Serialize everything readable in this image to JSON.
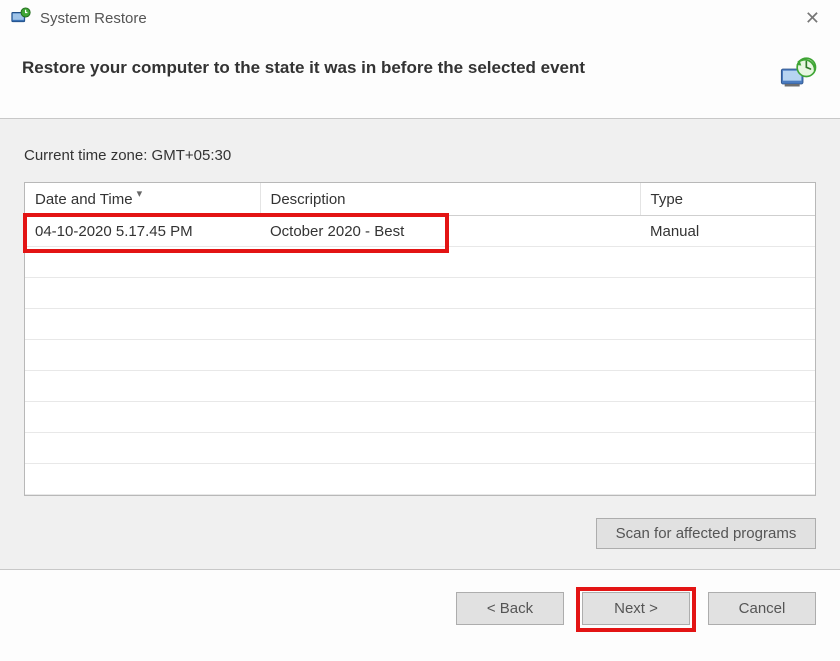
{
  "window": {
    "title": "System Restore"
  },
  "header": {
    "heading": "Restore your computer to the state it was in before the selected event"
  },
  "body": {
    "timezone_label": "Current time zone: GMT+05:30",
    "columns": {
      "date": "Date and Time",
      "desc": "Description",
      "type": "Type"
    },
    "rows": [
      {
        "date": "04-10-2020 5.17.45 PM",
        "desc": "October 2020 - Best",
        "type": "Manual"
      }
    ],
    "scan_button": "Scan for affected programs"
  },
  "footer": {
    "back": "< Back",
    "next": "Next >",
    "cancel": "Cancel"
  }
}
